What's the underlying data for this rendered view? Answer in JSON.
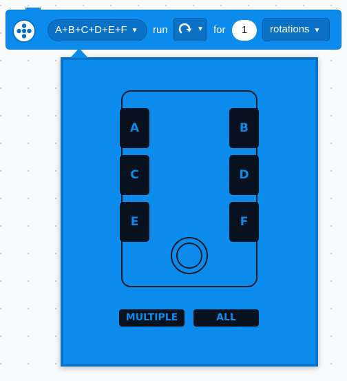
{
  "block": {
    "ports_value": "A+B+C+D+E+F",
    "run_label": "run",
    "direction_icon": "clockwise-arrow-icon",
    "for_label": "for",
    "amount_value": "1",
    "unit_value": "rotations"
  },
  "port_selector": {
    "ports": [
      "A",
      "B",
      "C",
      "D",
      "E",
      "F"
    ],
    "multiple_label": "MULTIPLE",
    "all_label": "ALL"
  },
  "colors": {
    "block_blue": "#0b8bec",
    "block_dark_blue": "#0a72c6",
    "port_fill": "#07121e",
    "input_white": "#ffffff"
  }
}
